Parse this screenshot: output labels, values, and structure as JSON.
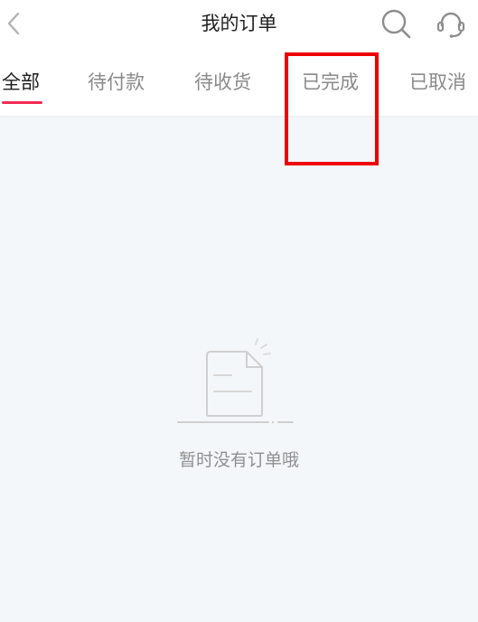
{
  "header": {
    "title": "我的订单",
    "icons": {
      "back": "chevron-left-icon",
      "search": "search-icon",
      "service": "headset-icon"
    }
  },
  "tabs": [
    {
      "label": "全部",
      "active": true
    },
    {
      "label": "待付款",
      "active": false
    },
    {
      "label": "待收货",
      "active": false
    },
    {
      "label": "已完成",
      "active": false
    },
    {
      "label": "已取消",
      "active": false
    }
  ],
  "empty_state": {
    "icon": "empty-document-icon",
    "text": "暂时没有订单哦"
  },
  "colors": {
    "accent": "#f02c52",
    "highlight": "#ee0000",
    "background": "#f4f7fa"
  }
}
